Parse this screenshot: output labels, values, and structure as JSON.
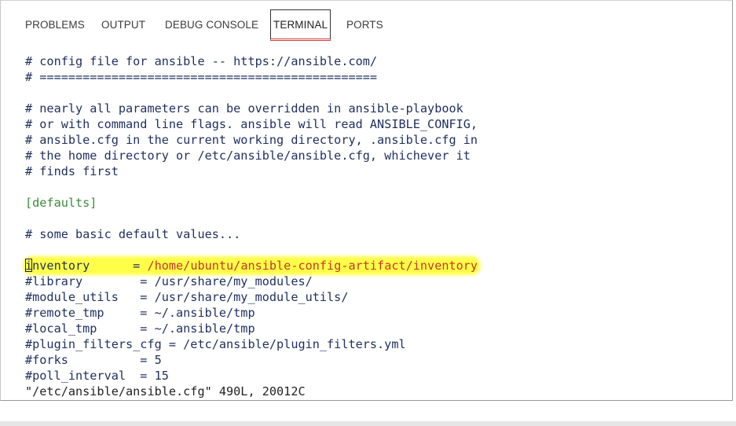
{
  "tabs": [
    {
      "label": "PROBLEMS"
    },
    {
      "label": "OUTPUT"
    },
    {
      "label": "DEBUG CONSOLE"
    },
    {
      "label": "TERMINAL"
    },
    {
      "label": "PORTS"
    }
  ],
  "active_tab": "TERMINAL",
  "terminal": {
    "lines": [
      "# config file for ansible -- https://ansible.com/",
      "# ===============================================",
      "",
      "# nearly all parameters can be overridden in ansible-playbook",
      "# or with command line flags. ansible will read ANSIBLE_CONFIG,",
      "# ansible.cfg in the current working directory, .ansible.cfg in",
      "# the home directory or /etc/ansible/ansible.cfg, whichever it",
      "# finds first",
      "",
      "[defaults]",
      "",
      "# some basic default values...",
      ""
    ],
    "inventory_key": "inventory      = ",
    "inventory_value": "/home/ubuntu/ansible-config-artifact/inventory",
    "settings_lines": [
      "#library        = /usr/share/my_modules/",
      "#module_utils   = /usr/share/my_module_utils/",
      "#remote_tmp     = ~/.ansible/tmp",
      "#local_tmp      = ~/.ansible/tmp",
      "#plugin_filters_cfg = /etc/ansible/plugin_filters.yml",
      "#forks          = 5",
      "#poll_interval  = 15"
    ],
    "status_line": "\"/etc/ansible/ansible.cfg\" 490L, 20012C"
  },
  "colors": {
    "text": "#1f2f5e",
    "section": "#3d8a3d",
    "highlight": "#ffff4a",
    "highlight_text": "#c0392b"
  }
}
